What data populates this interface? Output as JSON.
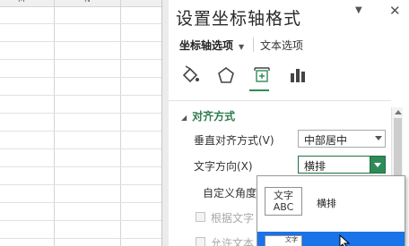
{
  "spreadsheet": {
    "column_letters": [
      "M",
      "N"
    ]
  },
  "pane": {
    "title": "设置坐标轴格式",
    "menu_icon": "chevron-down-icon",
    "close_icon": "close-icon",
    "tabs": {
      "active": "坐标轴选项",
      "inactive": "文本选项"
    },
    "icons": [
      "fill-line-icon",
      "effects-icon",
      "size-properties-icon",
      "axis-options-icon"
    ]
  },
  "alignment": {
    "section_title": "对齐方式",
    "vertical_align_label": "垂直对齐方式(V)",
    "vertical_align_value": "中部居中",
    "text_direction_label": "文字方向(X)",
    "text_direction_value": "横排",
    "custom_angle_label": "自定义角度",
    "checkbox_1_label": "根据文字",
    "checkbox_2_label": "允许文本"
  },
  "popup": {
    "option_1_icon_text_line1": "文字",
    "option_1_icon_text_line2": "ABC",
    "option_1_label": "横排",
    "option_2_icon_text": "文字"
  },
  "colors": {
    "accent_green": "#2e8b57",
    "selection_blue": "#1a73e8"
  }
}
